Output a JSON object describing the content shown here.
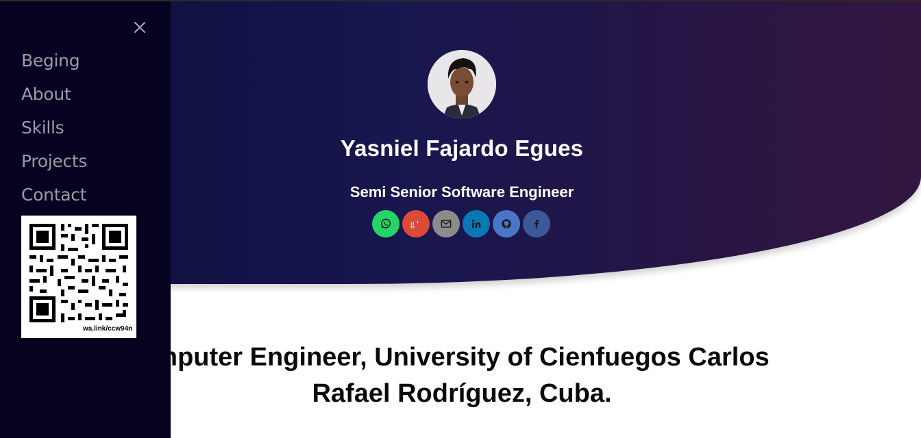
{
  "profile": {
    "name": "Yasniel Fajardo Egues",
    "subtitle": "Semi Senior Software Engineer"
  },
  "social": [
    {
      "name": "whatsapp",
      "icon": "whatsapp-icon",
      "color": "#25d366"
    },
    {
      "name": "google-plus",
      "icon": "google-plus-icon",
      "color": "#dc4a38"
    },
    {
      "name": "email",
      "icon": "email-icon",
      "color": "#8c8c8c"
    },
    {
      "name": "linkedin",
      "icon": "linkedin-icon",
      "color": "#0a78b5"
    },
    {
      "name": "github",
      "icon": "github-icon",
      "color": "#4a76c9"
    },
    {
      "name": "facebook",
      "icon": "facebook-icon",
      "color": "#3b5998"
    }
  ],
  "headline": {
    "line1": "mputer Engineer, University of Cienfuegos Carlos",
    "line2": "Rafael Rodríguez, Cuba."
  },
  "sidebar": {
    "items": [
      {
        "label": "Beging"
      },
      {
        "label": "About"
      },
      {
        "label": "Skills"
      },
      {
        "label": "Projects"
      },
      {
        "label": "Contact"
      }
    ],
    "qr_label": "wa.link/ccw94n"
  },
  "colors": {
    "hero_start": "#0c0c3a",
    "hero_end": "#33163f",
    "sidebar_bg": "#05031f",
    "nav_text": "#9b9ba8"
  }
}
